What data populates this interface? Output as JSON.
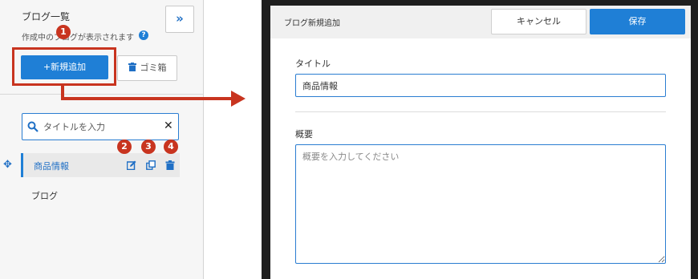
{
  "blog_panel": {
    "title": "ブログ一覧",
    "description": "作成中のブログが表示されます",
    "add_button_label": "+新規追加",
    "trash_button_label": "ゴミ箱",
    "search_placeholder": "タイトルを入力",
    "items": [
      {
        "label": "商品情報",
        "active": true
      },
      {
        "label": "ブログ",
        "active": false
      }
    ]
  },
  "badges": [
    "1",
    "2",
    "3",
    "4"
  ],
  "dialog": {
    "title": "ブログ新規追加",
    "cancel_label": "キャンセル",
    "save_label": "保存",
    "title_field_label": "タイトル",
    "title_field_value": "商品情報",
    "summary_field_label": "概要",
    "summary_placeholder": "概要を入力してください"
  },
  "icons": {
    "collapse": "double-chevron-right-icon",
    "help": "question-circle-icon",
    "trash": "trash-icon",
    "search": "search-icon",
    "clear": "close-icon",
    "move": "move-arrows-icon",
    "edit": "edit-icon",
    "copy": "copy-icon",
    "delete": "trash-icon"
  },
  "colors": {
    "accent": "#1f7fd6",
    "highlight": "#c8341f",
    "dialog_frame": "#1e1e1e"
  }
}
